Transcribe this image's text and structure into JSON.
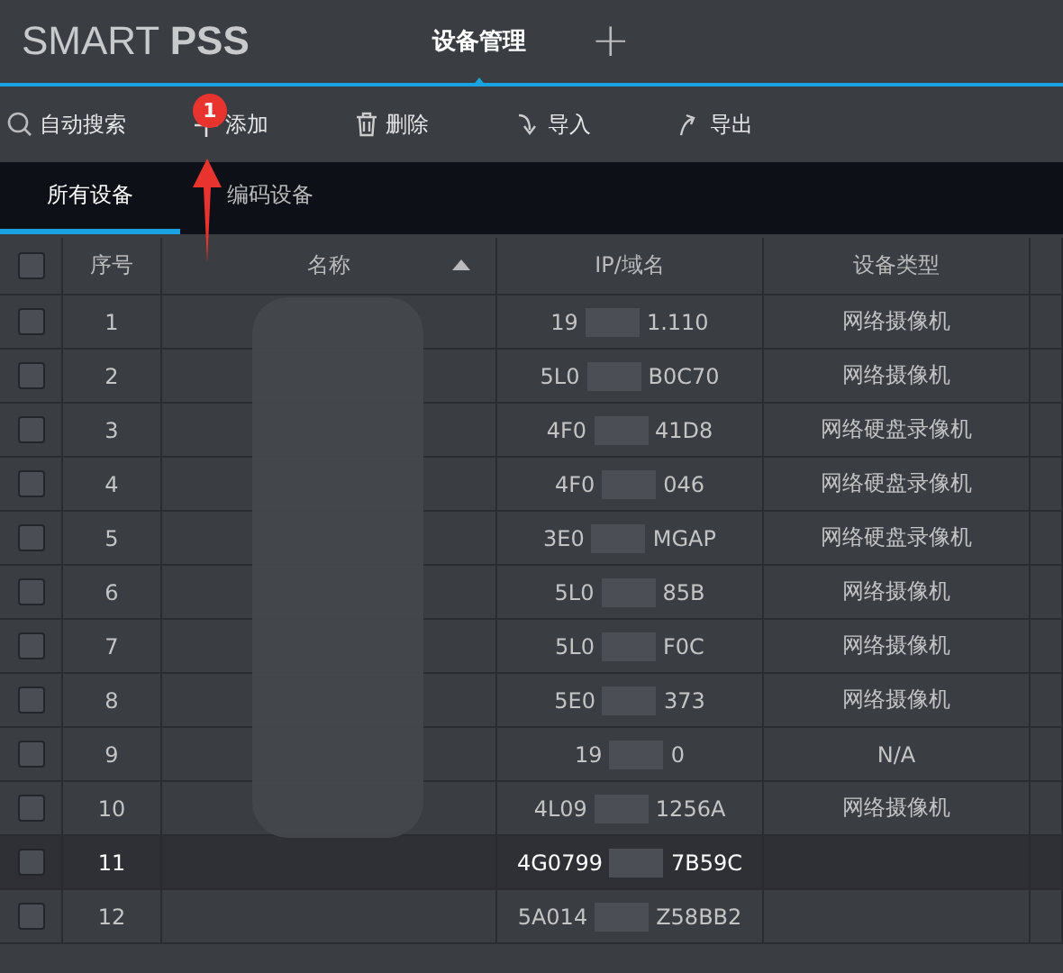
{
  "app": {
    "logo_light": "SMART",
    "logo_bold": "PSS",
    "tabs": [
      {
        "label": "设备管理",
        "selected": true
      }
    ],
    "add_tab": "+"
  },
  "toolbar": [
    {
      "kind": "search",
      "label": "自动搜索"
    },
    {
      "kind": "add",
      "label": "添加"
    },
    {
      "kind": "delete",
      "label": "删除"
    },
    {
      "kind": "import",
      "label": "导入"
    },
    {
      "kind": "export",
      "label": "导出"
    }
  ],
  "annotation": {
    "badge": "1"
  },
  "device_tabs": [
    {
      "label": "所有设备",
      "selected": true
    },
    {
      "label": "编码设备",
      "selected": false
    }
  ],
  "table": {
    "select_all": {
      "checked": false
    },
    "columns": [
      {
        "label": "序号",
        "sorted": false
      },
      {
        "label": "名称",
        "sorted": true
      },
      {
        "label": "IP/域名",
        "sorted": false
      },
      {
        "label": "设备类型",
        "sorted": false
      }
    ],
    "rows": [
      {
        "index": "1",
        "ip": [
          "19",
          "1.110"
        ],
        "type": "网络摄像机",
        "selected": false,
        "checked": false
      },
      {
        "index": "2",
        "ip": [
          "5L0",
          "B0C70"
        ],
        "type": "网络摄像机",
        "selected": false,
        "checked": false
      },
      {
        "index": "3",
        "ip": [
          "4F0",
          "41D8"
        ],
        "type": "网络硬盘录像机",
        "selected": false,
        "checked": false
      },
      {
        "index": "4",
        "ip": [
          "4F0",
          "046"
        ],
        "type": "网络硬盘录像机",
        "selected": false,
        "checked": false
      },
      {
        "index": "5",
        "ip": [
          "3E0",
          "MGAP"
        ],
        "type": "网络硬盘录像机",
        "selected": false,
        "checked": false
      },
      {
        "index": "6",
        "ip": [
          "5L0",
          "85B"
        ],
        "type": "网络摄像机",
        "selected": false,
        "checked": false
      },
      {
        "index": "7",
        "ip": [
          "5L0",
          "F0C"
        ],
        "type": "网络摄像机",
        "selected": false,
        "checked": false
      },
      {
        "index": "8",
        "ip": [
          "5E0",
          "373"
        ],
        "type": "网络摄像机",
        "selected": false,
        "checked": false
      },
      {
        "index": "9",
        "ip": [
          "19",
          "0"
        ],
        "type": "N/A",
        "selected": false,
        "checked": false
      },
      {
        "index": "10",
        "ip": [
          "4L09",
          "1256A"
        ],
        "type": "网络摄像机",
        "selected": false,
        "checked": false
      },
      {
        "index": "11",
        "ip": [
          "4G0799",
          "7B59C"
        ],
        "selected": true,
        "checked": false
      },
      {
        "index": "12",
        "ip": [
          "5A014",
          "Z58BB2"
        ],
        "selected": false,
        "checked": false
      }
    ]
  }
}
